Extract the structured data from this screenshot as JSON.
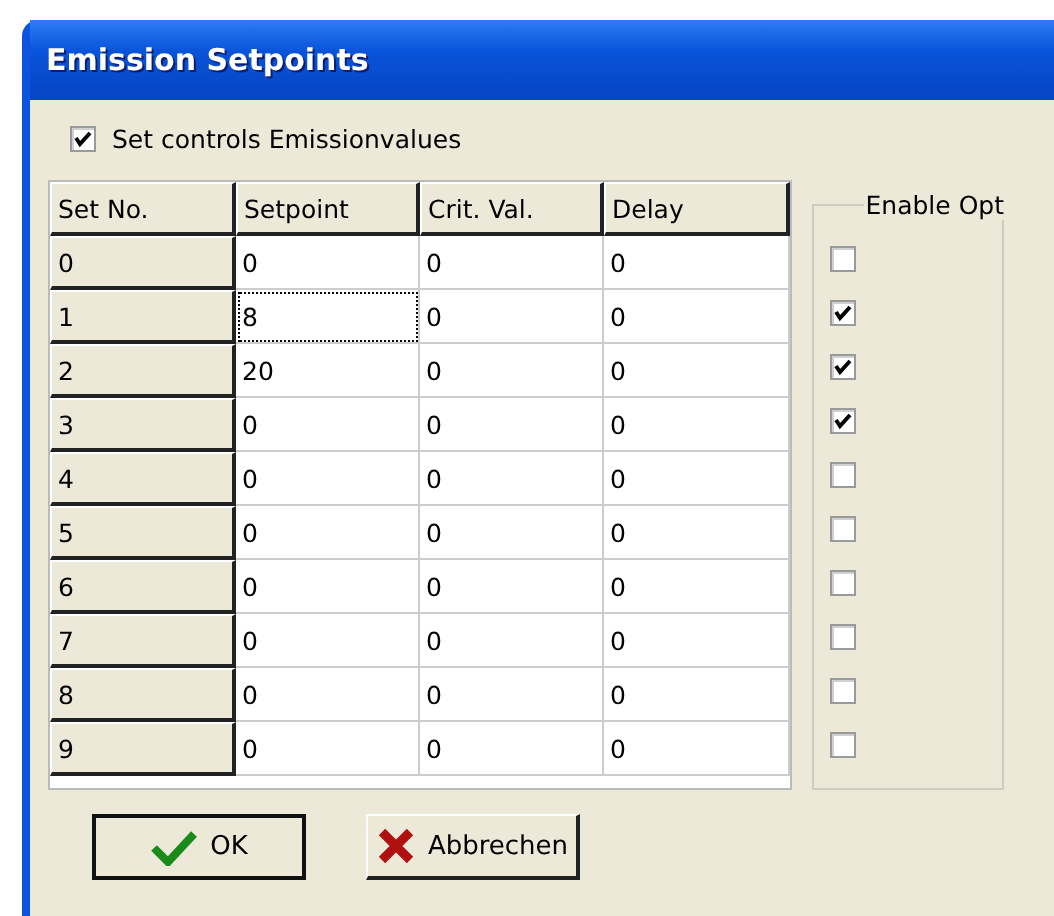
{
  "window": {
    "title": "Emission Setpoints"
  },
  "set_controls": {
    "label": "Set controls Emissionvalues",
    "checked": true
  },
  "table": {
    "columns": [
      "Set No.",
      "Setpoint",
      "Crit. Val.",
      "Delay"
    ],
    "rows": [
      {
        "set_no": "0",
        "setpoint": "0",
        "crit_val": "0",
        "delay": "0",
        "focused": false
      },
      {
        "set_no": "1",
        "setpoint": "8",
        "crit_val": "0",
        "delay": "0",
        "focused": true
      },
      {
        "set_no": "2",
        "setpoint": "20",
        "crit_val": "0",
        "delay": "0",
        "focused": false
      },
      {
        "set_no": "3",
        "setpoint": "0",
        "crit_val": "0",
        "delay": "0",
        "focused": false
      },
      {
        "set_no": "4",
        "setpoint": "0",
        "crit_val": "0",
        "delay": "0",
        "focused": false
      },
      {
        "set_no": "5",
        "setpoint": "0",
        "crit_val": "0",
        "delay": "0",
        "focused": false
      },
      {
        "set_no": "6",
        "setpoint": "0",
        "crit_val": "0",
        "delay": "0",
        "focused": false
      },
      {
        "set_no": "7",
        "setpoint": "0",
        "crit_val": "0",
        "delay": "0",
        "focused": false
      },
      {
        "set_no": "8",
        "setpoint": "0",
        "crit_val": "0",
        "delay": "0",
        "focused": false
      },
      {
        "set_no": "9",
        "setpoint": "0",
        "crit_val": "0",
        "delay": "0",
        "focused": false
      }
    ]
  },
  "enable_opt": {
    "title": "Enable Opt",
    "items": [
      {
        "checked": false
      },
      {
        "checked": true
      },
      {
        "checked": true
      },
      {
        "checked": true
      },
      {
        "checked": false
      },
      {
        "checked": false
      },
      {
        "checked": false
      },
      {
        "checked": false
      },
      {
        "checked": false
      },
      {
        "checked": false
      }
    ]
  },
  "buttons": [
    {
      "kind": "ok",
      "label": "OK"
    },
    {
      "kind": "cancel",
      "label": "Abbrechen"
    }
  ]
}
